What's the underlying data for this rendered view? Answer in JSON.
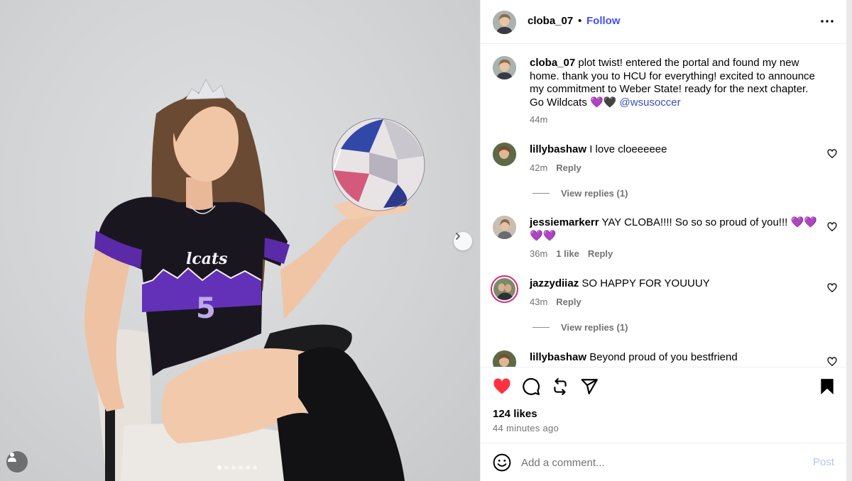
{
  "post": {
    "username": "cloba_07",
    "separator": "•",
    "follow_label": "Follow",
    "more_icon": "more-horizontal-icon",
    "carousel": {
      "slide_count": 6,
      "active_index": 0
    }
  },
  "caption": {
    "username": "cloba_07",
    "text": "plot twist! entered the portal and found my new home. thank you to HCU for everything! excited to announce my commitment to Weber State! ready for the next chapter. Go Wildcats 💜🖤",
    "mention": "@wsusoccer",
    "time": "44m"
  },
  "comments": [
    {
      "username": "lillybashaw",
      "text": "I love cloeeeeee",
      "time": "42m",
      "likes": "",
      "reply": "Reply",
      "view_replies": "View replies (1)"
    },
    {
      "username": "jessiemarkerr",
      "text": "YAY CLOBA!!!! So so so proud of you!!! 💜💜💜💜",
      "time": "36m",
      "likes": "1 like",
      "reply": "Reply",
      "view_replies": ""
    },
    {
      "username": "jazzydiiaz",
      "text": "SO HAPPY FOR YOUUUY",
      "time": "43m",
      "likes": "",
      "reply": "Reply",
      "view_replies": "View replies (1)"
    },
    {
      "username": "lillybashaw",
      "text": "Beyond proud of you bestfriend",
      "time": "",
      "likes": "",
      "reply": "",
      "view_replies": ""
    }
  ],
  "actions": {
    "like_icon": "heart-filled-icon",
    "comment_icon": "comment-icon",
    "repost_icon": "repost-icon",
    "share_icon": "send-icon",
    "save_icon": "bookmark-filled-icon",
    "liked": true,
    "like_color": "#ff3040"
  },
  "stats": {
    "likes": "124 likes",
    "time_ago": "44 minutes ago"
  },
  "add_comment": {
    "placeholder": "Add a comment...",
    "post_label": "Post",
    "emoji_icon": "smiley-icon"
  },
  "colors": {
    "accent": "#4150f7",
    "mention": "#3a4fb8",
    "muted": "#737373"
  }
}
